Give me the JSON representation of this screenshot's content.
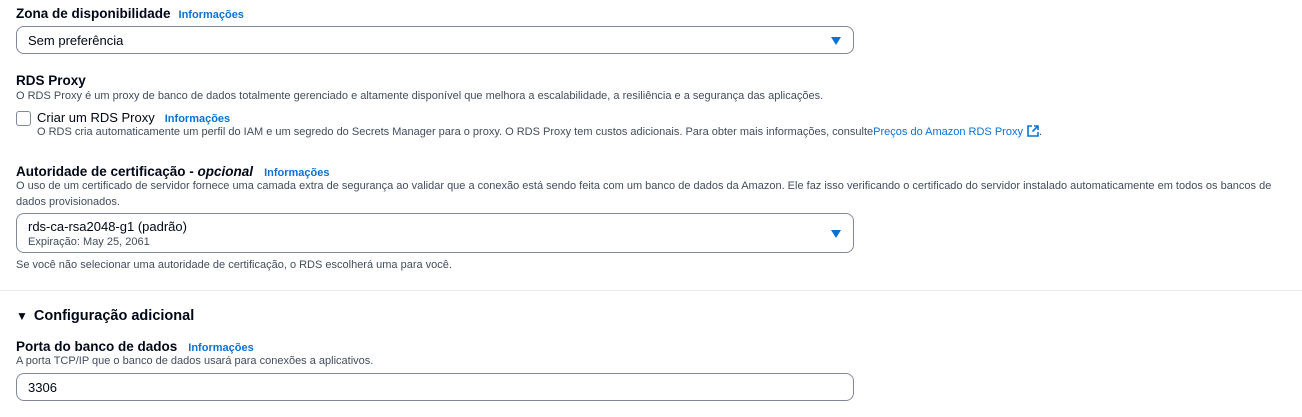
{
  "availability_zone": {
    "label": "Zona de disponibilidade",
    "info": "Informações",
    "value": "Sem preferência"
  },
  "rds_proxy": {
    "heading": "RDS Proxy",
    "description": "O RDS Proxy é um proxy de banco de dados totalmente gerenciado e altamente disponível que melhora a escalabilidade, a resiliência e a segurança das aplicações.",
    "checkbox_label": "Criar um RDS Proxy",
    "checked": false,
    "info": "Informações",
    "checkbox_desc": "O RDS cria automaticamente um perfil do IAM e um segredo do Secrets Manager para o proxy. O RDS Proxy tem custos adicionais. Para obter mais informações, consulte",
    "pricing_link": "Preços do Amazon RDS Proxy",
    "pricing_suffix": "."
  },
  "certificate_authority": {
    "label": "Autoridade de certificação - ",
    "optional": "opcional",
    "info": "Informações",
    "description": "O uso de um certificado de servidor fornece uma camada extra de segurança ao validar que a conexão está sendo feita com um banco de dados da Amazon. Ele faz isso verificando o certificado do servidor instalado automaticamente em todos os bancos de dados provisionados.",
    "value": "rds-ca-rsa2048-g1 (padrão)",
    "expiration": "Expiração: May 25, 2061",
    "hint": "Se você não selecionar uma autoridade de certificação, o RDS escolherá uma para você."
  },
  "additional_config": {
    "toggle": "▼",
    "title": "Configuração adicional"
  },
  "db_port": {
    "label": "Porta do banco de dados",
    "info": "Informações",
    "description": "A porta TCP/IP que o banco de dados usará para conexões a aplicativos.",
    "value": "3306"
  },
  "colors": {
    "accent": "#0972d3",
    "text": "#000716",
    "secondary_text": "#414d5c",
    "border": "#7d8998"
  }
}
